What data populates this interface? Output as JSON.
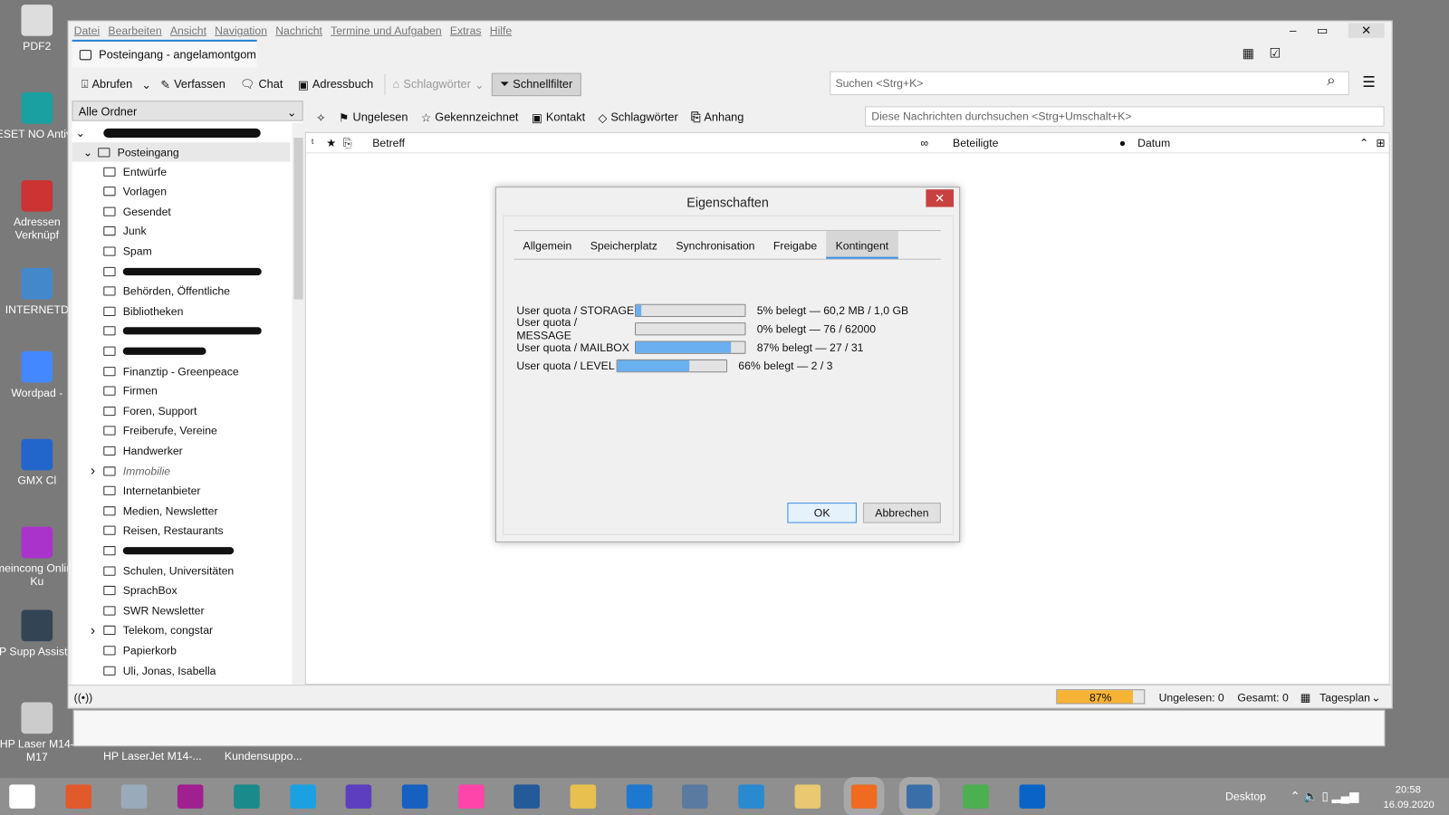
{
  "desktop": {
    "icons": [
      "PDF2",
      "ESET NO Antivir",
      "Adressen Verknüpf",
      "INTERNETD",
      "Wordpad -",
      "GMX Cl",
      "meincong Online Ku",
      "HP Supp Assistent",
      "HP Laser M14-M17"
    ],
    "extra_labels": [
      "HP LaserJet M14-...",
      "Kundensuppo..."
    ]
  },
  "menubar": [
    "Datei",
    "Bearbeiten",
    "Ansicht",
    "Navigation",
    "Nachricht",
    "Termine und Aufgaben",
    "Extras",
    "Hilfe"
  ],
  "tab": {
    "label": "Posteingang - angelamontgom"
  },
  "toolbar": {
    "abrufen": "Abrufen",
    "verfassen": "Verfassen",
    "chat": "Chat",
    "adressbuch": "Adressbuch",
    "schlagwoerter": "Schlagwörter",
    "schnellfilter": "Schnellfilter",
    "search_placeholder": "Suchen <Strg+K>"
  },
  "folders": {
    "header": "Alle Ordner",
    "inbox": "Posteingang",
    "items": [
      "Entwürfe",
      "Vorlagen",
      "Gesendet",
      "Junk",
      "Spam",
      "",
      "Behörden, Öffentliche",
      "Bibliotheken",
      "",
      "",
      "Finanztip - Greenpeace",
      "Firmen",
      "Foren, Support",
      "Freiberufe, Vereine",
      "Handwerker",
      "Immobilie",
      "Internetanbieter",
      "Medien, Newsletter",
      "Reisen, Restaurants",
      "",
      "Schulen, Universitäten",
      "SprachBox",
      "SWR Newsletter",
      "Telekom,  congstar",
      "Papierkorb",
      "Uli, Jonas, Isabella"
    ]
  },
  "quickfilter": {
    "ungelesen": "Ungelesen",
    "gekennzeichnet": "Gekennzeichnet",
    "kontakt": "Kontakt",
    "schlagwoerter": "Schlagwörter",
    "anhang": "Anhang",
    "search_placeholder": "Diese Nachrichten durchsuchen <Strg+Umschalt+K>"
  },
  "columns": {
    "betreff": "Betreff",
    "beteiligte": "Beteiligte",
    "datum": "Datum"
  },
  "dialog": {
    "title": "Eigenschaften",
    "tabs": [
      "Allgemein",
      "Speicherplatz",
      "Synchronisation",
      "Freigabe",
      "Kontingent"
    ],
    "active_tab": "Kontingent",
    "quotas": [
      {
        "label": "User quota / STORAGE",
        "percent": 5,
        "text": "5% belegt — 60,2 MB / 1,0 GB"
      },
      {
        "label": "User quota / MESSAGE",
        "percent": 0,
        "text": "0% belegt — 76 / 62000"
      },
      {
        "label": "User quota / MAILBOX",
        "percent": 87,
        "text": "87% belegt — 27 / 31"
      },
      {
        "label": "User quota / LEVEL",
        "percent": 66,
        "text": "66% belegt — 2 / 3"
      }
    ],
    "ok": "OK",
    "cancel": "Abbrechen"
  },
  "status": {
    "quota": "87%",
    "quota_percent": 87,
    "unread": "Ungelesen: 0",
    "total": "Gesamt: 0",
    "tagesplan": "Tagesplan"
  },
  "taskbar": {
    "desktop": "Desktop",
    "time": "20:58",
    "date": "16.09.2020"
  },
  "colors": {
    "accent": "#2a7fd4",
    "quota_bar": "#6aaff0",
    "status_quota": "#f7b334",
    "close": "#c94040"
  }
}
